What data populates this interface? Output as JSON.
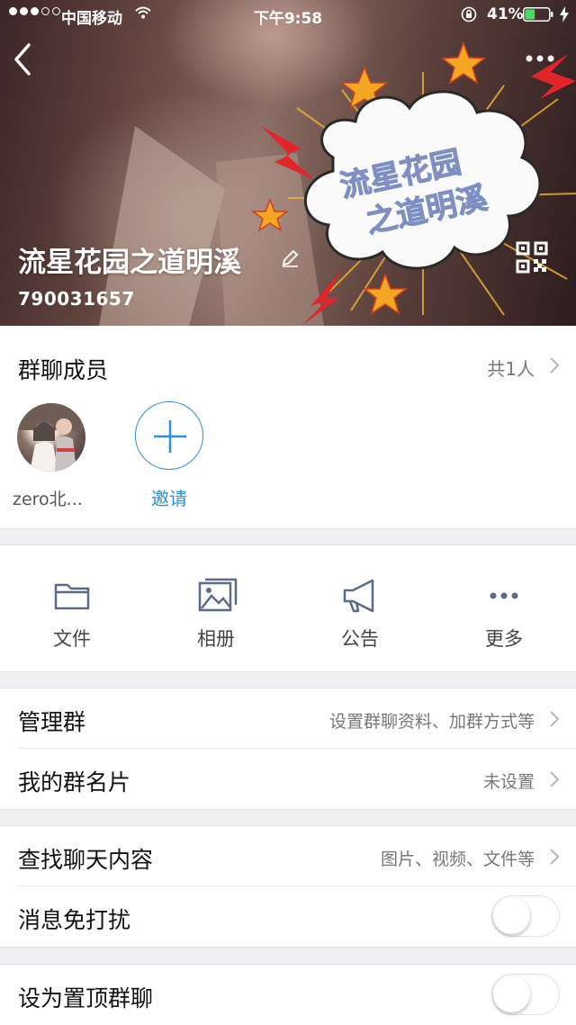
{
  "status_bar": {
    "carrier": "中国移动",
    "time": "下午9:58",
    "battery": "41%",
    "battery_level": 0.41
  },
  "header": {
    "group_name": "流星花园之道明溪",
    "group_id": "790031657",
    "sticker_text_line1": "流星花园",
    "sticker_text_line2": "之道明溪"
  },
  "members": {
    "title": "群聊成员",
    "count": "共1人",
    "list": [
      {
        "name": "zero北..."
      }
    ],
    "invite_label": "邀请"
  },
  "tools": [
    {
      "label": "文件",
      "icon": "folder-icon"
    },
    {
      "label": "相册",
      "icon": "photo-album-icon"
    },
    {
      "label": "公告",
      "icon": "megaphone-icon"
    },
    {
      "label": "更多",
      "icon": "more-dots-icon"
    }
  ],
  "settings": {
    "manage": {
      "label": "管理群",
      "value": "设置群聊资料、加群方式等"
    },
    "card": {
      "label": "我的群名片",
      "value": "未设置"
    },
    "search": {
      "label": "查找聊天内容",
      "value": "图片、视频、文件等"
    },
    "mute": {
      "label": "消息免打扰",
      "on": false
    },
    "pin": {
      "label": "设为置顶群聊",
      "on": false
    }
  },
  "colors": {
    "accent": "#2e8fd8",
    "background": "#f0f0f3"
  }
}
